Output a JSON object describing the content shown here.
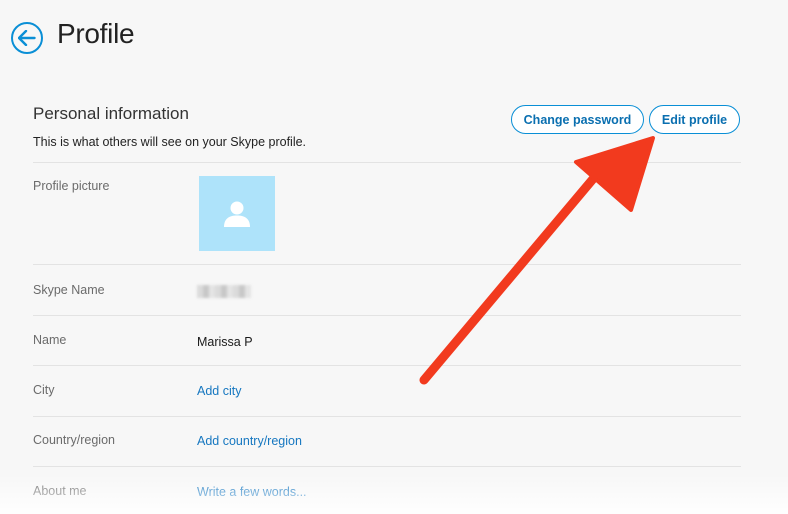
{
  "header": {
    "title": "Profile"
  },
  "section": {
    "title": "Personal information",
    "subtitle": "This is what others will see on your Skype profile."
  },
  "buttons": {
    "change_password": "Change password",
    "edit_profile": "Edit profile"
  },
  "rows": {
    "profile_picture": {
      "label": "Profile picture"
    },
    "skype_name": {
      "label": "Skype Name"
    },
    "name": {
      "label": "Name",
      "value": "Marissa P"
    },
    "city": {
      "label": "City",
      "value": "Add city"
    },
    "country": {
      "label": "Country/region",
      "value": "Add country/region"
    },
    "about": {
      "label": "About me",
      "value": "Write a few words..."
    }
  },
  "colors": {
    "accent": "#0a8fd6",
    "link": "#1677c0",
    "annotation_arrow": "#f23a1e",
    "avatar_bg": "#aee3fa"
  },
  "icons": [
    "back-arrow-icon",
    "user-placeholder-icon"
  ]
}
